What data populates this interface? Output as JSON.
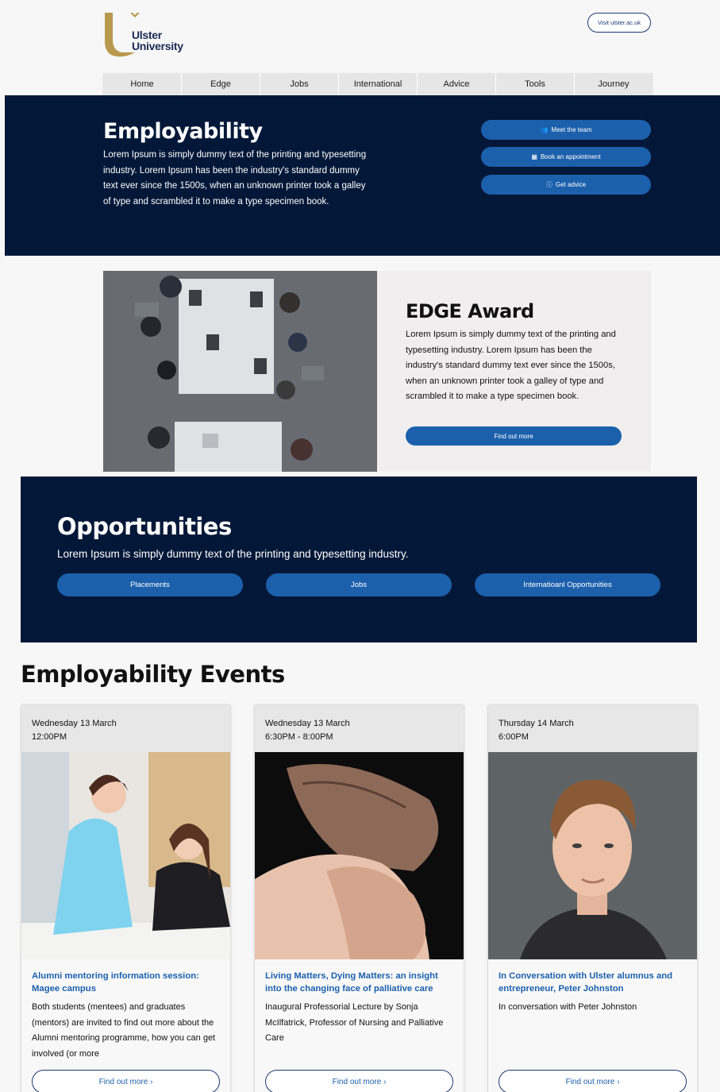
{
  "brand": {
    "name_line1": "Ulster",
    "name_line2": "University",
    "visit_label": "Visit ulster.ac.uk"
  },
  "nav": {
    "items": [
      "Home",
      "Edge",
      "Jobs",
      "International",
      "Advice",
      "Tools",
      "Journey"
    ]
  },
  "hero": {
    "title": "Employability",
    "text": "Lorem Ipsum is simply dummy text of the printing and typesetting industry. Lorem Ipsum has been the industry's standard dummy text ever since the 1500s, when an unknown printer took a galley of type and scrambled it to make a type specimen book.",
    "buttons": [
      {
        "label": "Meet the team",
        "icon": "users-icon"
      },
      {
        "label": "Book an appointment",
        "icon": "calendar-icon"
      },
      {
        "label": "Get advice",
        "icon": "info-icon"
      }
    ]
  },
  "edge": {
    "title": "EDGE Award",
    "text": "Lorem Ipsum is simply dummy text of the printing and typesetting industry. Lorem Ipsum has been the industry's standard dummy text ever since the 1500s, when an unknown printer took a galley of type and scrambled it to make a type specimen book.",
    "button_label": "Find out more"
  },
  "opportunities": {
    "title": "Opportunities",
    "text": "Lorem Ipsum is simply dummy text of the printing and typesetting industry.",
    "buttons": [
      "Placements",
      "Jobs",
      "Internatioanl Opportunities"
    ]
  },
  "events": {
    "title": "Employability Events",
    "items": [
      {
        "date": "Wednesday 13 March",
        "time": "12:00PM",
        "title": "Alumni mentoring information session: Magee campus",
        "desc": "Both students (mentees) and graduates (mentors) are invited to find out more about the Alumni mentoring programme, how you can get involved (or more",
        "button": "Find out more ›"
      },
      {
        "date": "Wednesday 13 March",
        "time": "6:30PM - 8:00PM",
        "title": "Living Matters, Dying Matters: an insight into the changing face of palliative care",
        "desc": "Inaugural Professorial Lecture by Sonja McIlfatrick, Professor of Nursing and Palliative Care",
        "button": "Find out more ›"
      },
      {
        "date": "Thursday 14 March",
        "time": "6:00PM",
        "title": "In Conversation with Ulster alumnus and entrepreneur, Peter Johnston",
        "desc": "In conversation with Peter Johnston",
        "button": "Find out more ›"
      }
    ]
  },
  "colors": {
    "navy": "#031838",
    "accent_blue": "#1c60ac",
    "logo_gold": "#b8994e"
  }
}
